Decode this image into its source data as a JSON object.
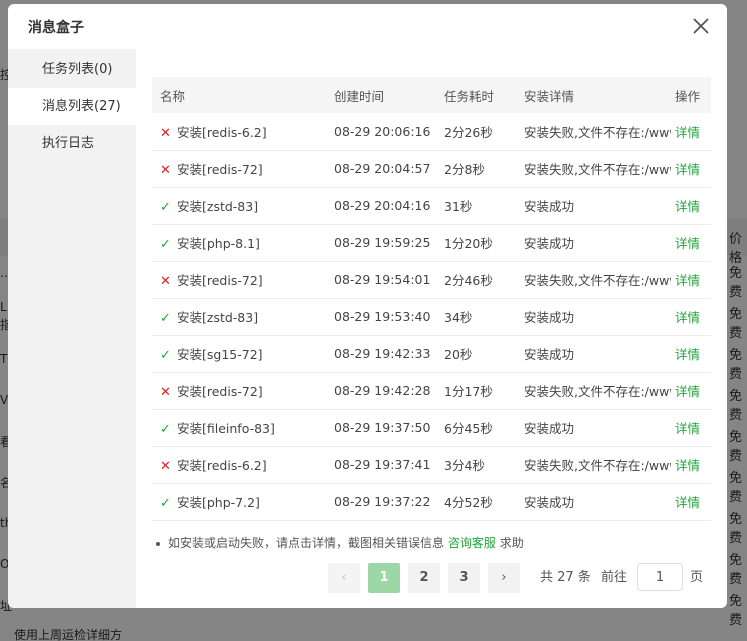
{
  "dialog": {
    "title": "消息盒子",
    "close_icon": "close-icon"
  },
  "sidebar": {
    "items": [
      {
        "label": "任务列表(0)",
        "active": false
      },
      {
        "label": "消息列表(27)",
        "active": true
      },
      {
        "label": "执行日志",
        "active": false
      }
    ]
  },
  "table": {
    "headers": [
      "名称",
      "创建时间",
      "任务耗时",
      "安装详情",
      "操作"
    ],
    "rows": [
      {
        "status": "fail",
        "name": "安装[redis-6.2]",
        "time": "08-29 20:06:16",
        "duration": "2分26秒",
        "detail": "安装失败,文件不存在:/www/server/panel/install/redis.sh",
        "op": "详情"
      },
      {
        "status": "fail",
        "name": "安装[redis-72]",
        "time": "08-29 20:04:57",
        "duration": "2分8秒",
        "detail": "安装失败,文件不存在:/www/server/panel/install/redis.sh",
        "op": "详情"
      },
      {
        "status": "ok",
        "name": "安装[zstd-83]",
        "time": "08-29 20:04:16",
        "duration": "31秒",
        "detail": "安装成功",
        "op": "详情"
      },
      {
        "status": "ok",
        "name": "安装[php-8.1]",
        "time": "08-29 19:59:25",
        "duration": "1分20秒",
        "detail": "安装成功",
        "op": "详情"
      },
      {
        "status": "fail",
        "name": "安装[redis-72]",
        "time": "08-29 19:54:01",
        "duration": "2分46秒",
        "detail": "安装失败,文件不存在:/www/server/panel/install/redis.sh",
        "op": "详情"
      },
      {
        "status": "ok",
        "name": "安装[zstd-83]",
        "time": "08-29 19:53:40",
        "duration": "34秒",
        "detail": "安装成功",
        "op": "详情"
      },
      {
        "status": "ok",
        "name": "安装[sg15-72]",
        "time": "08-29 19:42:33",
        "duration": "20秒",
        "detail": "安装成功",
        "op": "详情"
      },
      {
        "status": "fail",
        "name": "安装[redis-72]",
        "time": "08-29 19:42:28",
        "duration": "1分17秒",
        "detail": "安装失败,文件不存在:/www/server/panel/install/redis.sh",
        "op": "详情"
      },
      {
        "status": "ok",
        "name": "安装[fileinfo-83]",
        "time": "08-29 19:37:50",
        "duration": "6分45秒",
        "detail": "安装成功",
        "op": "详情"
      },
      {
        "status": "fail",
        "name": "安装[redis-6.2]",
        "time": "08-29 19:37:41",
        "duration": "3分4秒",
        "detail": "安装失败,文件不存在:/www/server/panel/install/redis.sh",
        "op": "详情"
      },
      {
        "status": "ok",
        "name": "安装[php-7.2]",
        "time": "08-29 19:37:22",
        "duration": "4分52秒",
        "detail": "安装成功",
        "op": "详情"
      }
    ]
  },
  "tip": {
    "text": "如安装或启动失败，请点击详情，截图相关错误信息",
    "link": "咨询客服",
    "suffix": "求助"
  },
  "pager": {
    "prev": "‹",
    "pages": [
      "1",
      "2",
      "3"
    ],
    "current": "1",
    "next": "›",
    "total_text": "共 27 条",
    "goto_label": "前往",
    "goto_value": "1",
    "page_unit": "页"
  },
  "background": {
    "right_header": "价格",
    "right_cells": [
      "免费",
      "免费",
      "免费",
      "免费",
      "免费",
      "免费",
      "免费",
      "免费",
      "免费"
    ],
    "left_fragments": [
      "控",
      "…",
      "L",
      "指",
      "Th",
      "Ve",
      "看",
      "名",
      "th",
      "Ob",
      "址"
    ],
    "bottom_text": "使用上周运检详细方"
  },
  "colors": {
    "success": "#20a53a",
    "fail": "#e02020",
    "pager_current": "#9ed7a6"
  }
}
